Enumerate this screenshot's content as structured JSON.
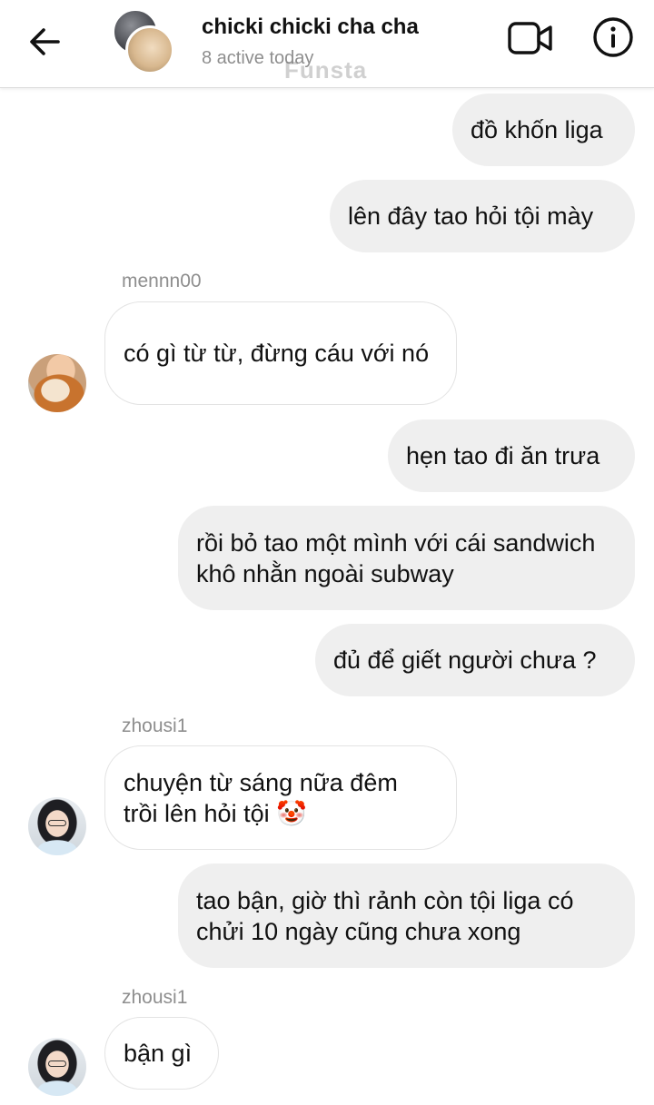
{
  "header": {
    "title": "chicki chicki cha cha",
    "status": "8 active today",
    "watermark": "Funsta",
    "icons": {
      "back": "back-arrow-icon",
      "video": "video-call-icon",
      "info": "info-icon"
    }
  },
  "messages": [
    {
      "direction": "out",
      "text": "đồ khốn liga"
    },
    {
      "direction": "out",
      "text": "lên đây tao hỏi tội mày"
    },
    {
      "direction": "in",
      "sender": "mennn00",
      "text": "có gì từ từ, đừng cáu với nó"
    },
    {
      "direction": "out",
      "text": "hẹn tao đi ăn trưa"
    },
    {
      "direction": "out",
      "text": "rồi bỏ tao một mình với cái sandwich khô nhằn ngoài subway"
    },
    {
      "direction": "out",
      "text": "đủ để giết người chưa ?"
    },
    {
      "direction": "in",
      "sender": "zhousi1",
      "text": "chuyện từ sáng nữa đêm trồi lên hỏi tội 🤡"
    },
    {
      "direction": "out",
      "text": "tao bận, giờ thì rảnh còn tội liga có chửi 10 ngày cũng chưa xong"
    },
    {
      "direction": "in",
      "sender": "zhousi1",
      "text": "bận gì"
    }
  ],
  "colors": {
    "outgoing_bubble": "#efefef",
    "incoming_border": "#e3e3e3",
    "secondary_text": "#8e8e8e"
  }
}
